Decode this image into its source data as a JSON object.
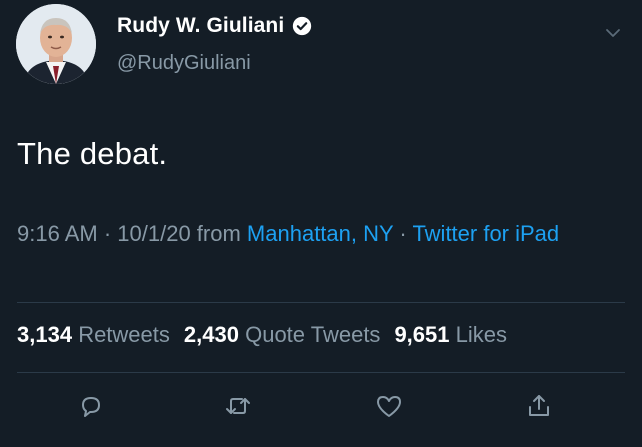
{
  "author": {
    "display_name": "Rudy W. Giuliani",
    "handle": "@RudyGiuliani",
    "verified": true
  },
  "tweet": {
    "text": "The debat.",
    "time": "9:16 AM",
    "separator_1": " · ",
    "date": "10/1/20",
    "from_label": " from ",
    "location": "Manhattan, NY",
    "separator_2": " · ",
    "source": "Twitter for iPad"
  },
  "stats": {
    "retweets_count": "3,134",
    "retweets_label": "Retweets",
    "quote_tweets_count": "2,430",
    "quote_tweets_label": "Quote Tweets",
    "likes_count": "9,651",
    "likes_label": "Likes"
  },
  "icons": {
    "reply": "comment-icon",
    "retweet": "retweet-icon",
    "like": "heart-icon",
    "share": "share-icon",
    "menu": "chevron-down-icon",
    "verified": "verified-badge-icon"
  },
  "colors": {
    "background": "#141d26",
    "text_primary": "#ffffff",
    "text_secondary": "#8899a6",
    "link": "#1da1f2",
    "divider": "#2b3a48"
  }
}
